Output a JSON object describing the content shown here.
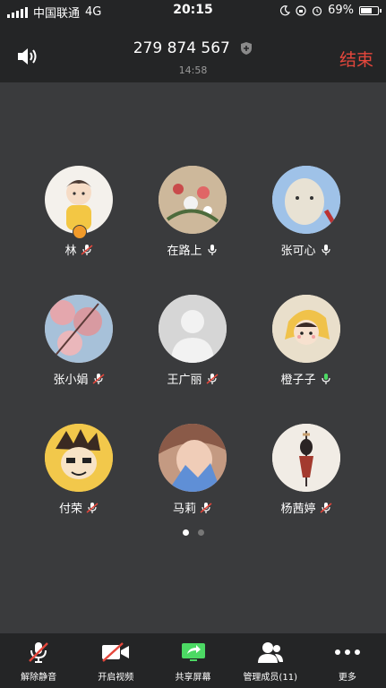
{
  "status_bar": {
    "carrier": "中国联通",
    "network": "4G",
    "time": "20:15",
    "battery": "69%",
    "battery_level": 0.69
  },
  "header": {
    "meeting_id": "279 874 567",
    "duration": "14:58",
    "end_label": "结束",
    "end_color": "#e5473c"
  },
  "members": [
    {
      "name": "林",
      "mic": "muted",
      "host": true,
      "avatar": "avatar-cartoon-boy"
    },
    {
      "name": "在路上",
      "mic": "on",
      "host": false,
      "avatar": "avatar-flowers"
    },
    {
      "name": "张可心",
      "mic": "on",
      "host": false,
      "avatar": "avatar-cat-figure"
    },
    {
      "name": "张小娟",
      "mic": "muted",
      "host": false,
      "avatar": "avatar-cherry-blossom"
    },
    {
      "name": "王广丽",
      "mic": "muted",
      "host": false,
      "avatar": "avatar-default"
    },
    {
      "name": "橙子子",
      "mic": "speaking",
      "host": false,
      "avatar": "avatar-cartoon-girl"
    },
    {
      "name": "付荣",
      "mic": "muted",
      "host": false,
      "avatar": "avatar-anime"
    },
    {
      "name": "马莉",
      "mic": "muted",
      "host": false,
      "avatar": "avatar-selfie"
    },
    {
      "name": "杨茜婷",
      "mic": "muted",
      "host": false,
      "avatar": "avatar-figurine"
    }
  ],
  "pagination": {
    "pages": 2,
    "current": 1
  },
  "toolbar": [
    {
      "label": "解除静音",
      "icon": "mic-muted-icon"
    },
    {
      "label": "开启视频",
      "icon": "video-off-icon"
    },
    {
      "label": "共享屏幕",
      "icon": "share-screen-icon"
    },
    {
      "label": "管理成员(11)",
      "icon": "members-icon"
    },
    {
      "label": "更多",
      "icon": "more-icon"
    }
  ]
}
